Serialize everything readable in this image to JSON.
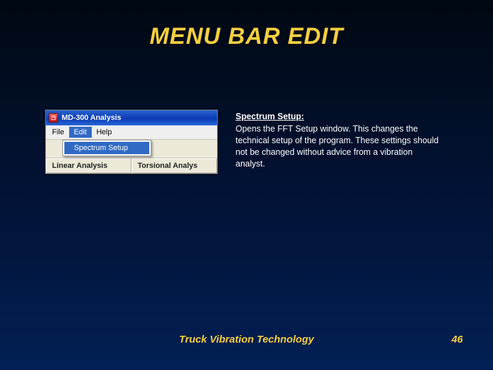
{
  "slide": {
    "title": "MENU BAR EDIT",
    "footer_text": "Truck Vibration Technology",
    "page_number": "46"
  },
  "app_window": {
    "title": "MD-300 Analysis",
    "menubar": {
      "items": [
        "File",
        "Edit",
        "Help"
      ],
      "selected_index": 1
    },
    "dropdown": {
      "items": [
        "Spectrum Setup"
      ],
      "highlighted_index": 0
    },
    "toolbar": {
      "buttons": [
        "Linear Analysis",
        "Torsional Analys"
      ]
    }
  },
  "description": {
    "heading": "Spectrum Setup:",
    "body": "Opens the FFT Setup window. This changes the technical setup of the program. These settings should not be changed without advice from a vibration analyst."
  }
}
